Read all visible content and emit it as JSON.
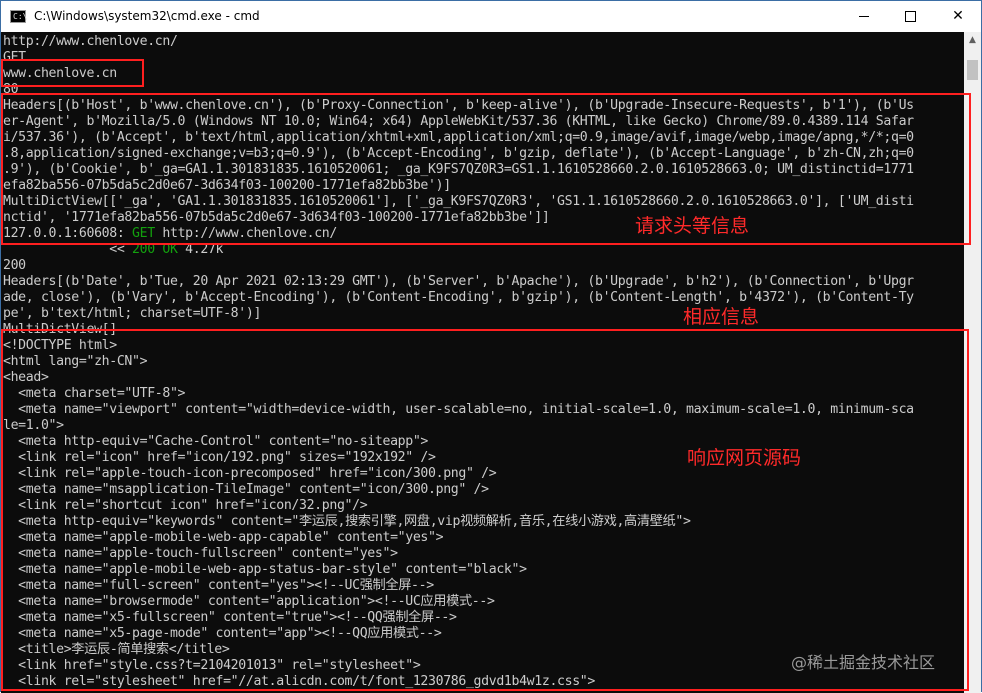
{
  "window": {
    "title": "C:\\Windows\\system32\\cmd.exe - cmd"
  },
  "window_buttons": {
    "minimize": "—",
    "maximize": "☐",
    "close": "✕"
  },
  "scrollbar": {
    "up_arrow": "▲"
  },
  "console_lines": [
    "http://www.chenlove.cn/",
    "GET",
    "www.chenlove.cn",
    "80",
    "Headers[(b'Host', b'www.chenlove.cn'), (b'Proxy-Connection', b'keep-alive'), (b'Upgrade-Insecure-Requests', b'1'), (b'Us",
    "er-Agent', b'Mozilla/5.0 (Windows NT 10.0; Win64; x64) AppleWebKit/537.36 (KHTML, like Gecko) Chrome/89.0.4389.114 Safar",
    "i/537.36'), (b'Accept', b'text/html,application/xhtml+xml,application/xml;q=0.9,image/avif,image/webp,image/apng,*/*;q=0",
    ".8,application/signed-exchange;v=b3;q=0.9'), (b'Accept-Encoding', b'gzip, deflate'), (b'Accept-Language', b'zh-CN,zh;q=0",
    ".9'), (b'Cookie', b'_ga=GA1.1.301831835.1610520061; _ga_K9FS7QZ0R3=GS1.1.1610528660.2.0.1610528663.0; UM_distinctid=1771",
    "efa82ba556-07b5da5c2d0e67-3d634f03-100200-1771efa82bb3be')]",
    "MultiDictView[['_ga', 'GA1.1.301831835.1610520061'], ['_ga_K9FS7QZ0R3', 'GS1.1.1610528660.2.0.1610528663.0'], ['UM_disti",
    "nctid', '1771efa82ba556-07b5da5c2d0e67-3d634f03-100200-1771efa82bb3be']]",
    "127.0.0.1:60608: GET http://www.chenlove.cn/",
    "              << 200 OK 4.27k",
    "200",
    "Headers[(b'Date', b'Tue, 20 Apr 2021 02:13:29 GMT'), (b'Server', b'Apache'), (b'Upgrade', b'h2'), (b'Connection', b'Upgr",
    "ade, close'), (b'Vary', b'Accept-Encoding'), (b'Content-Encoding', b'gzip'), (b'Content-Length', b'4372'), (b'Content-Ty",
    "pe', b'text/html; charset=UTF-8')]",
    "MultiDictView[]",
    "<!DOCTYPE html>",
    "<html lang=\"zh-CN\">",
    "<head>",
    "  <meta charset=\"UTF-8\">",
    "  <meta name=\"viewport\" content=\"width=device-width, user-scalable=no, initial-scale=1.0, maximum-scale=1.0, minimum-sca",
    "le=1.0\">",
    "  <meta http-equiv=\"Cache-Control\" content=\"no-siteapp\">",
    "  <link rel=\"icon\" href=\"icon/192.png\" sizes=\"192x192\" />",
    "  <link rel=\"apple-touch-icon-precomposed\" href=\"icon/300.png\" />",
    "  <meta name=\"msapplication-TileImage\" content=\"icon/300.png\" />",
    "  <link rel=\"shortcut icon\" href=\"icon/32.png\"/>",
    "  <meta http-equiv=\"keywords\" content=\"李运辰,搜索引擎,网盘,vip视频解析,音乐,在线小游戏,高清壁纸\">",
    "  <meta name=\"apple-mobile-web-app-capable\" content=\"yes\">",
    "  <meta name=\"apple-touch-fullscreen\" content=\"yes\">",
    "  <meta name=\"apple-mobile-web-app-status-bar-style\" content=\"black\">",
    "  <meta name=\"full-screen\" content=\"yes\"><!--UC强制全屏-->",
    "  <meta name=\"browsermode\" content=\"application\"><!--UC应用模式-->",
    "  <meta name=\"x5-fullscreen\" content=\"true\"><!--QQ强制全屏-->",
    "  <meta name=\"x5-page-mode\" content=\"app\"><!--QQ应用模式-->",
    "  <title>李运辰-简单搜索</title>",
    "  <link href=\"style.css?t=2104201013\" rel=\"stylesheet\">",
    "  <link rel=\"stylesheet\" href=\"//at.alicdn.com/t/font_1230786_gdvd1b4w1z.css\">"
  ],
  "annotations": {
    "request_info": "请求头等信息",
    "response_info": "相应信息",
    "response_source": "响应网页源码"
  },
  "watermark": "@稀土掘金技术社区",
  "colors": {
    "console_bg": "#0c0c0c",
    "console_text": "#cccccc",
    "status_ok": "#13a10e",
    "annotation_red": "#ff1f1f"
  }
}
